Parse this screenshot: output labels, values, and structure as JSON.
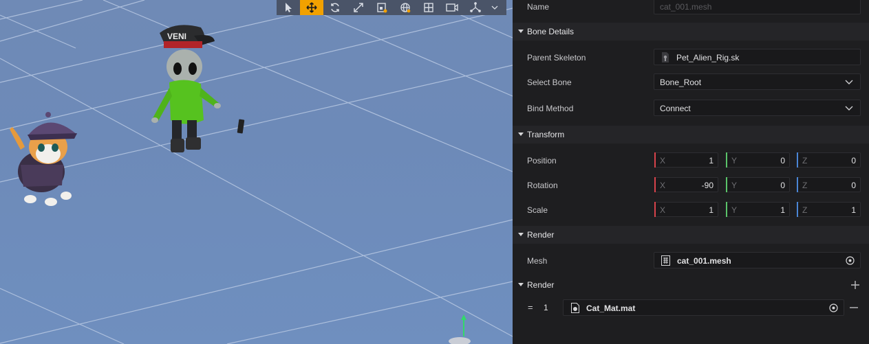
{
  "viewport": {
    "background": "#6e8cba",
    "grid_color": "#b8c8e2",
    "toolbar": {
      "tools": [
        {
          "name": "select-tool-icon",
          "active": false
        },
        {
          "name": "move-tool-icon",
          "active": true
        },
        {
          "name": "rotate-tool-icon",
          "active": false
        },
        {
          "name": "scale-tool-icon",
          "active": false
        },
        {
          "name": "rect-tool-icon",
          "active": false
        },
        {
          "name": "world-space-icon",
          "active": false
        },
        {
          "name": "snap-grid-icon",
          "active": false
        },
        {
          "name": "camera-icon",
          "active": false
        },
        {
          "name": "gizmo-axes-icon",
          "active": false
        },
        {
          "name": "chevron-down-icon",
          "active": false
        }
      ],
      "bg": "#4a5468",
      "active_color": "#f2a100"
    },
    "alien_cap_text": "VENI"
  },
  "inspector": {
    "name_label": "Name",
    "name_value": "cat_001.mesh",
    "bone_details_title": "Bone Details",
    "parent_skeleton_label": "Parent Skeleton",
    "parent_skeleton_value": "Pet_Alien_Rig.sk",
    "select_bone_label": "Select Bone",
    "select_bone_value": "Bone_Root",
    "bind_method_label": "Bind Method",
    "bind_method_value": "Connect",
    "transform_title": "Transform",
    "position_label": "Position",
    "rotation_label": "Rotation",
    "scale_label": "Scale",
    "axis_x": "X",
    "axis_y": "Y",
    "axis_z": "Z",
    "position": {
      "x": "1",
      "y": "0",
      "z": "0"
    },
    "rotation": {
      "x": "-90",
      "y": "0",
      "z": "0"
    },
    "scale": {
      "x": "1",
      "y": "1",
      "z": "1"
    },
    "render_title": "Render",
    "mesh_label": "Mesh",
    "mesh_value": "cat_001.mesh",
    "render2_title": "Render",
    "material_handle": "=",
    "material_index": "1",
    "material_value": "Cat_Mat.mat",
    "axis_colors": {
      "x": "#d9434b",
      "y": "#5bc46a",
      "z": "#4a86d6"
    }
  }
}
